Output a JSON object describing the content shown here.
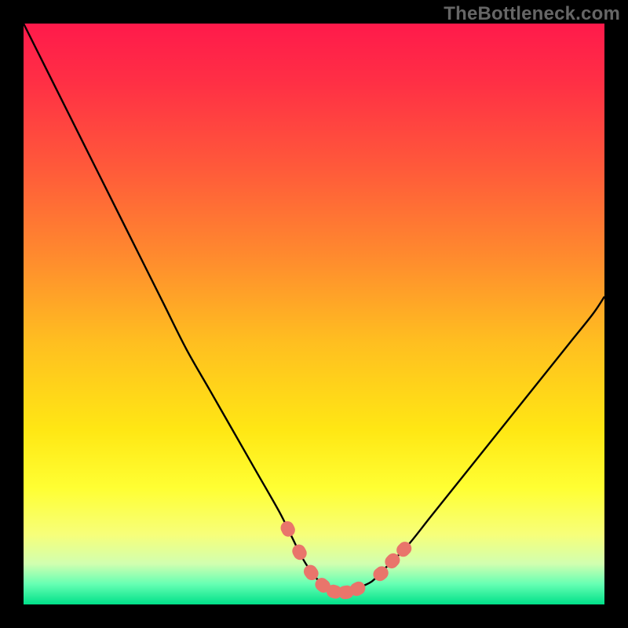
{
  "watermark": "TheBottleneck.com",
  "colors": {
    "frame": "#000000",
    "curve": "#000000",
    "marker_fill": "#e9756b",
    "marker_stroke": "#c95b54",
    "gradient_stops": [
      {
        "offset": 0.0,
        "color": "#ff1a4b"
      },
      {
        "offset": 0.1,
        "color": "#ff2f45"
      },
      {
        "offset": 0.25,
        "color": "#ff5a3a"
      },
      {
        "offset": 0.4,
        "color": "#ff8a2e"
      },
      {
        "offset": 0.55,
        "color": "#ffbf20"
      },
      {
        "offset": 0.7,
        "color": "#ffe714"
      },
      {
        "offset": 0.8,
        "color": "#ffff33"
      },
      {
        "offset": 0.88,
        "color": "#f7ff7a"
      },
      {
        "offset": 0.93,
        "color": "#d1ffb0"
      },
      {
        "offset": 0.965,
        "color": "#66ffb3"
      },
      {
        "offset": 1.0,
        "color": "#00e089"
      }
    ]
  },
  "chart_data": {
    "type": "line",
    "title": "",
    "xlabel": "",
    "ylabel": "",
    "xlim": [
      0,
      100
    ],
    "ylim": [
      0,
      100
    ],
    "grid": false,
    "series": [
      {
        "name": "bottleneck-curve",
        "x": [
          0,
          4,
          8,
          12,
          16,
          20,
          24,
          28,
          32,
          36,
          40,
          44,
          46,
          48,
          50,
          52,
          54,
          56,
          58,
          60,
          62,
          66,
          70,
          74,
          78,
          82,
          86,
          90,
          94,
          98,
          100
        ],
        "y": [
          100,
          92,
          84,
          76,
          68,
          60,
          52,
          44,
          37,
          30,
          23,
          16,
          12,
          8,
          5,
          3,
          2,
          2,
          3,
          4,
          6,
          10,
          15,
          20,
          25,
          30,
          35,
          40,
          45,
          50,
          53
        ]
      }
    ],
    "markers": {
      "name": "highlight-dots",
      "x": [
        45.5,
        47.5,
        49.5,
        51.5,
        53.5,
        55.5,
        57.5,
        61.5,
        63.5,
        65.5
      ],
      "y": [
        13,
        9,
        5.5,
        3.3,
        2.2,
        2.1,
        2.7,
        5.3,
        7.5,
        9.5
      ]
    }
  }
}
